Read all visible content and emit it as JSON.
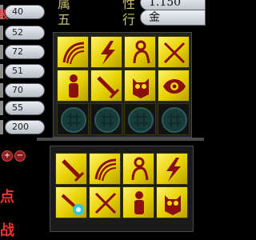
{
  "stats": [
    {
      "value": "40",
      "mark": "段"
    },
    {
      "value": "52",
      "mark": ""
    },
    {
      "value": "72",
      "mark": ""
    },
    {
      "value": "51",
      "mark": ""
    },
    {
      "value": "70",
      "mark": ""
    },
    {
      "value": "55",
      "mark": ""
    },
    {
      "value": "200",
      "mark": ""
    }
  ],
  "header": {
    "top_label_left": "属",
    "top_label_right": "性",
    "top_value": "1.150",
    "wuxing_label_1": "五",
    "wuxing_label_2": "行",
    "wuxing_value": "金"
  },
  "left_controls": {
    "plus": "+",
    "minus": "−",
    "glyph_1": "点",
    "glyph_2": "战"
  },
  "equipped_grid": [
    [
      "swirl-icon",
      "lightning-icon",
      "kneeling-figure-icon",
      "crossed-swords-icon"
    ],
    [
      "warrior-icon",
      "sword-icon",
      "owl-icon",
      "eye-swirl-icon"
    ],
    [
      "empty-slot",
      "empty-slot",
      "empty-slot",
      "empty-slot"
    ]
  ],
  "inventory_grid": [
    [
      "sword-icon",
      "swirl-icon",
      "kneeling-figure-icon",
      "lightning-icon"
    ],
    [
      "glowing-orb-sword-icon",
      "crossed-swords-icon",
      "warrior-icon",
      "owl-icon"
    ]
  ],
  "colors": {
    "slot_gold": "#f2e000",
    "icon_red": "#8a1010",
    "empty_slot": "#121212",
    "label_gold": "#c9c06a"
  }
}
